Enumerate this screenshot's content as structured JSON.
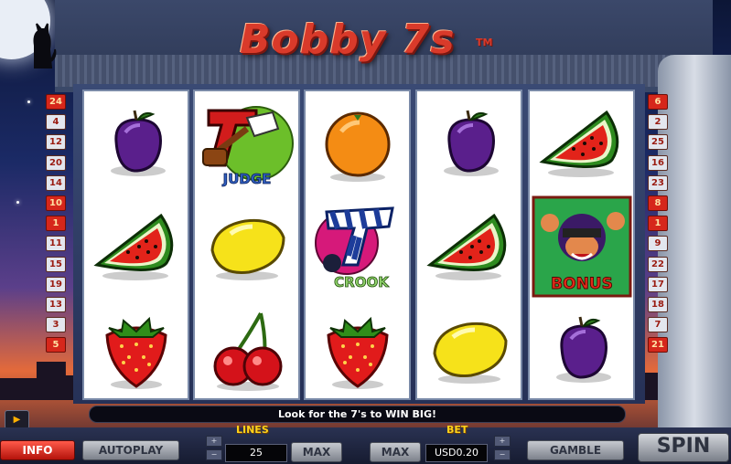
{
  "game": {
    "title": "Bobby 7s",
    "trademark": "TM",
    "message": "Look for the 7's to WIN BIG!"
  },
  "paylines": {
    "left": [
      "24",
      "4",
      "12",
      "20",
      "14",
      "10",
      "1",
      "11",
      "15",
      "19",
      "13",
      "3",
      "5"
    ],
    "right": [
      "6",
      "2",
      "25",
      "16",
      "23",
      "8",
      "1",
      "9",
      "22",
      "17",
      "18",
      "7",
      "21"
    ]
  },
  "reels": [
    [
      "plum",
      "watermelon",
      "strawberry"
    ],
    [
      "judge",
      "lemon",
      "cherries"
    ],
    [
      "orange",
      "crook",
      "strawberry"
    ],
    [
      "plum",
      "watermelon",
      "lemon"
    ],
    [
      "watermelon",
      "bonus",
      "plum"
    ]
  ],
  "symbol_labels": {
    "judge": "JUDGE",
    "crook": "CROOK",
    "bonus": "BONUS"
  },
  "controls": {
    "info": "INFO",
    "autoplay": "AUTOPLAY",
    "lines_label": "LINES",
    "lines_value": "25",
    "lines_max": "MAX",
    "bet_label": "BET",
    "bet_max": "MAX",
    "bet_value": "USD0.20",
    "gamble": "GAMBLE",
    "spin": "SPIN",
    "plus": "+",
    "minus": "−"
  },
  "colors": {
    "title_red": "#d93a2a",
    "label_yellow": "#ffd21a",
    "info_red": "#d6271b"
  }
}
